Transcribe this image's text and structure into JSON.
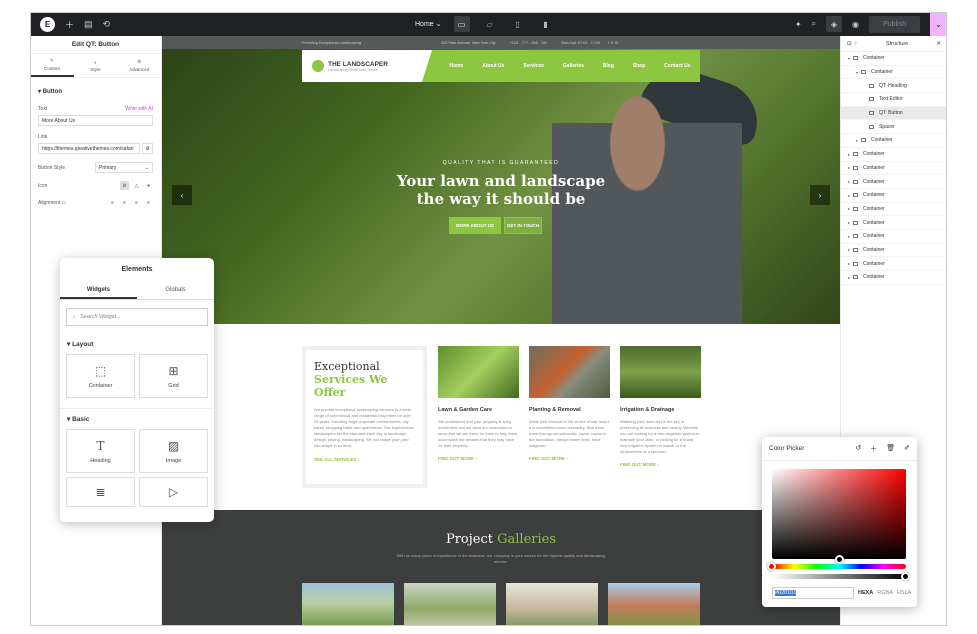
{
  "topbar": {
    "logo": "E",
    "page_selector": "Home",
    "publish_label": "Publish"
  },
  "left_panel": {
    "title": "Edit QT: Button",
    "tabs": [
      "Content",
      "Style",
      "Advanced"
    ],
    "section": "Button",
    "text_label": "Text",
    "ai_label": "Write with AI",
    "text_value": "More About Us",
    "link_label": "Link",
    "link_value": "https://themes.qreativethemes.com/safari",
    "style_label": "Button Style",
    "style_value": "Primary",
    "icon_label": "Icon",
    "align_label": "Alignment"
  },
  "site": {
    "topbar_left": "Providing Exceptional Landscaping",
    "topbar_address": "202 Park Avenue, New York City",
    "topbar_phone": "+123 - 777 - 456 - 789",
    "topbar_hours": "Mon-Sat: 07:00 - 17:00",
    "logo_title": "THE LANDSCAPER",
    "logo_sub": "Landscaping WordPress Theme",
    "menu": [
      "Home",
      "About Us",
      "Services",
      "Galleries",
      "Blog",
      "Shop",
      "Contact Us"
    ],
    "hero_tag": "QUALITY THAT IS GUARANTEED",
    "hero_line1": "Your lawn and landscape",
    "hero_line2": "the way it should be",
    "btn1": "MORE ABOUT US",
    "btn2": "GET IN TOUCH",
    "services": {
      "h1": "Exceptional",
      "h2": "Services We Offer",
      "para": "We provide exceptional landscaping services to a wide range of commercial and residential properties for over 25 years, including large corporate environments, city parks, shopping malls and apartments. Our experienced landscapers set the standard each day in landscape design, paving, hardscaping. We will shape your yard into shape in no time.",
      "link": "SEE ALL SERVICES ›"
    },
    "cards": [
      {
        "title": "Lawn & Garden Care",
        "para": "We understand that your property is a big investment and we want our customers to know that we are there for them to help them accomplish the dreams that they may have for their property...",
        "link": "FIND OUT MORE ›"
      },
      {
        "title": "Planting & Removal",
        "para": "While tree removal is the choice of last resort, it is sometimes most necessary. Sick trees, trees that uproot sidewalks, cause cracks in the foundation, disrupt sewer lines, have outgrown...",
        "link": "FIND OUT MORE ›"
      },
      {
        "title": "Irrigation & Drainage",
        "para": "Watering your lawn and is the key to preserving its lushness and beauty. Whether you are looking for a new irrigation system to maintain your lawn, or looking for a brand new irrigation system to install, or the replacement of a sprinkler...",
        "link": "FIND OUT MORE ›"
      }
    ],
    "gallery_h1": "Project",
    "gallery_h2": "Galleries",
    "gallery_p": "With so many years of experience in the business, our company is your source for the highest quality and landscaping service."
  },
  "structure": {
    "title": "Structure",
    "items": [
      {
        "label": "Container",
        "indent": 0,
        "caret": "▾"
      },
      {
        "label": "Container",
        "indent": 1,
        "caret": "▾"
      },
      {
        "label": "QT: Heading",
        "indent": 2,
        "caret": ""
      },
      {
        "label": "Text Editor",
        "indent": 2,
        "caret": ""
      },
      {
        "label": "QT: Button",
        "indent": 2,
        "caret": ""
      },
      {
        "label": "Spacer",
        "indent": 2,
        "caret": ""
      },
      {
        "label": "Container",
        "indent": 1,
        "caret": "▸"
      },
      {
        "label": "Container",
        "indent": 0,
        "caret": "▸"
      },
      {
        "label": "Container",
        "indent": 0,
        "caret": "▸"
      },
      {
        "label": "Container",
        "indent": 0,
        "caret": "▸"
      },
      {
        "label": "Container",
        "indent": 0,
        "caret": "▸"
      },
      {
        "label": "Container",
        "indent": 0,
        "caret": "▸"
      },
      {
        "label": "Container",
        "indent": 0,
        "caret": "▸"
      },
      {
        "label": "Container",
        "indent": 0,
        "caret": "▸"
      },
      {
        "label": "Container",
        "indent": 0,
        "caret": "▸"
      },
      {
        "label": "Container",
        "indent": 0,
        "caret": "▸"
      },
      {
        "label": "Container",
        "indent": 0,
        "caret": "▸"
      }
    ]
  },
  "elements": {
    "title": "Elements",
    "tab_widgets": "Widgets",
    "tab_globals": "Globals",
    "search_placeholder": "Search Widget...",
    "layout_label": "Layout",
    "basic_label": "Basic",
    "w_container": "Container",
    "w_grid": "Grid",
    "w_heading": "Heading",
    "w_image": "Image"
  },
  "picker": {
    "title": "Color Picker",
    "hex": "#020101",
    "modes": [
      "HEXA",
      "RGBA",
      "HSLA"
    ]
  },
  "colors": {
    "accent": "#8dc63f",
    "editor_dark": "#1f2124",
    "ai_pink": "#c944e0"
  }
}
